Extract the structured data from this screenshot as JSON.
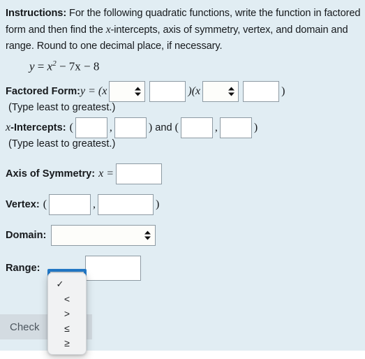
{
  "theme": {
    "page_background": "#e1edf3",
    "text_color": "#16191c",
    "input_border": "#8d9aa3",
    "focus_ring": "#2279c8",
    "button_background": "#d3dbe1",
    "button_text": "#4d565e",
    "popup_background": "#f1f2f3"
  },
  "instructions": {
    "label": "Instructions:",
    "text_part1": " For the following quadratic functions, write the function in factored form and then find the ",
    "math_x": "x",
    "text_part2": "-intercepts, axis of symmetry, vertex, and domain and range.  Round to one decimal place, if necessary."
  },
  "equation": {
    "lhs": "y",
    "equals": "=",
    "base": "x",
    "exponent": "2",
    "rest": "− 7x − 8",
    "full": "y = x² − 7x − 8"
  },
  "factored_form": {
    "label": "Factored Form:",
    "math_prefix": "y = (x",
    "mid_literal": ")(x",
    "close_literal": ")",
    "hint": "(Type least to greatest.)",
    "select1": {
      "value": "",
      "options": [
        "",
        "<",
        ">",
        "≤",
        "≥"
      ]
    },
    "input1": {
      "value": "",
      "placeholder": ""
    },
    "select2": {
      "value": "",
      "options": [
        "",
        "<",
        ">",
        "≤",
        "≥"
      ]
    },
    "input2": {
      "value": "",
      "placeholder": ""
    }
  },
  "x_intercepts": {
    "label_math": "x",
    "label": "-Intercepts:",
    "open_paren": "(",
    "comma": ",",
    "close_paren": ")",
    "and_text": "and",
    "hint": "(Type least to greatest.)",
    "input1": {
      "value": "",
      "placeholder": ""
    },
    "input2": {
      "value": "",
      "placeholder": ""
    },
    "input3": {
      "value": "",
      "placeholder": ""
    },
    "input4": {
      "value": "",
      "placeholder": ""
    }
  },
  "axis_of_symmetry": {
    "label": "Axis of Symmetry:",
    "math_prefix": "x =",
    "input": {
      "value": "",
      "placeholder": ""
    }
  },
  "vertex": {
    "label": "Vertex:",
    "open_paren": "(",
    "comma": ",",
    "close_paren": ")",
    "input1": {
      "value": "",
      "placeholder": ""
    },
    "input2": {
      "value": "",
      "placeholder": ""
    }
  },
  "domain": {
    "label": "Domain:",
    "select": {
      "value": "",
      "options": [
        "",
        "<",
        ">",
        "≤",
        "≥"
      ]
    }
  },
  "range": {
    "label": "Range:",
    "select": {
      "value": "",
      "options": [
        "",
        "<",
        ">",
        "≤",
        "≥"
      ]
    },
    "input": {
      "value": "",
      "placeholder": ""
    },
    "dropdown_open": true,
    "dropdown": {
      "selected_index": 0,
      "check_glyph": "✓",
      "options": [
        {
          "label": "",
          "selected": true
        },
        {
          "label": "<",
          "selected": false
        },
        {
          "label": ">",
          "selected": false
        },
        {
          "label": "≤",
          "selected": false
        },
        {
          "label": "≥",
          "selected": false
        }
      ]
    }
  },
  "actions": {
    "check_label": "Check"
  }
}
